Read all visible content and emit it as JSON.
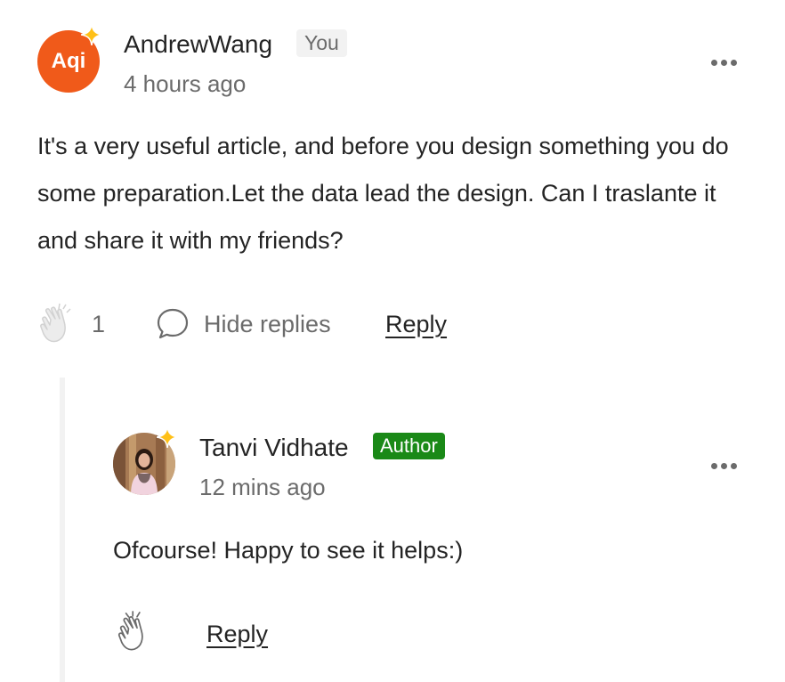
{
  "comment": {
    "avatar_text": "Aqi",
    "author": "AndrewWang",
    "badge": "You",
    "timestamp": "4 hours ago",
    "body": "It's a very useful article, and before you design something you do some preparation.Let the data lead the design. Can I traslante it and share it with my friends?",
    "clap_count": "1",
    "hide_replies_label": "Hide replies",
    "reply_label": "Reply",
    "more_icon": "more-horizontal-icon",
    "colors": {
      "avatar_bg": "#f05a1a",
      "star": "#ffc017"
    }
  },
  "reply": {
    "author": "Tanvi Vidhate",
    "badge": "Author",
    "timestamp": "12 mins ago",
    "body": "Ofcourse! Happy to see it helps:)",
    "reply_label": "Reply",
    "colors": {
      "author_badge_bg": "#1a8917"
    }
  }
}
